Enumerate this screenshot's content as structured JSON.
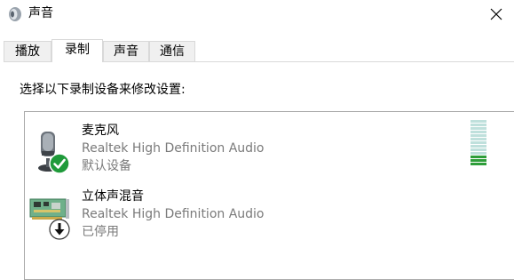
{
  "window": {
    "title": "声音",
    "icon": "speaker-icon",
    "close_icon": "close-icon"
  },
  "tabs": [
    {
      "label": "播放",
      "active": false
    },
    {
      "label": "录制",
      "active": true
    },
    {
      "label": "声音",
      "active": false
    },
    {
      "label": "通信",
      "active": false
    }
  ],
  "instruction": "选择以下录制设备来修改设置:",
  "devices": [
    {
      "name": "麦克风",
      "driver": "Realtek High Definition Audio",
      "status": "默认设备",
      "icon": "microphone-icon",
      "badge": "check-badge-icon"
    },
    {
      "name": "立体声混音",
      "driver": "Realtek High Definition Audio",
      "status": "已停用",
      "icon": "sound-card-icon",
      "badge": "disabled-badge-icon"
    }
  ],
  "level_meter": {
    "level_fraction": 0.2,
    "colors": {
      "active": "#2e9e3a",
      "inactive": "#bfe0dc"
    }
  },
  "colors": {
    "tab_border": "#d9d9d9",
    "list_border": "#aaaaaa",
    "secondary_text": "#7a7a7a",
    "badge_green": "#1f9a3a"
  }
}
